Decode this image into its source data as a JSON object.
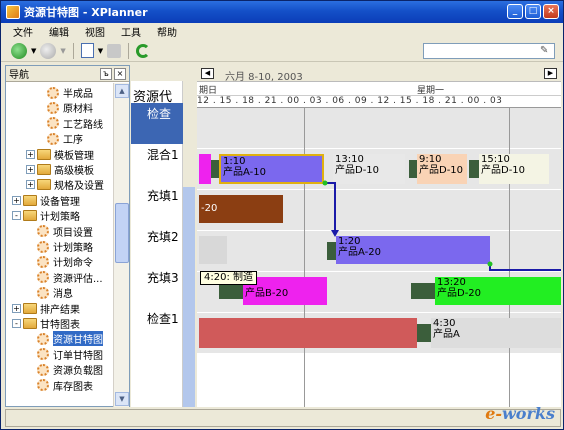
{
  "window": {
    "title": "资源甘特图 - XPlanner"
  },
  "menu": [
    "文件",
    "编辑",
    "视图",
    "工具",
    "帮助"
  ],
  "nav": {
    "title": "导航",
    "items": [
      {
        "label": "半成品",
        "level": 2,
        "icon": "gear-icon"
      },
      {
        "label": "原材料",
        "level": 2,
        "icon": "gear-icon"
      },
      {
        "label": "工艺路线",
        "level": 2,
        "icon": "gear-icon"
      },
      {
        "label": "工序",
        "level": 2,
        "icon": "gear-icon"
      },
      {
        "label": "模板管理",
        "level": 1,
        "icon": "folder-icon",
        "expander": "+"
      },
      {
        "label": "高级模板",
        "level": 1,
        "icon": "folder-icon",
        "expander": "+"
      },
      {
        "label": "规格及设置",
        "level": 1,
        "icon": "folder-icon",
        "expander": "+"
      },
      {
        "label": "设备管理",
        "level": 0,
        "icon": "folder-icon",
        "expander": "+"
      },
      {
        "label": "计划策略",
        "level": 0,
        "icon": "folder-icon",
        "expander": "-"
      },
      {
        "label": "项目设置",
        "level": 1,
        "icon": "gear-icon"
      },
      {
        "label": "计划策略",
        "level": 1,
        "icon": "gear-icon"
      },
      {
        "label": "计划命令",
        "level": 1,
        "icon": "gear-icon"
      },
      {
        "label": "资源评估...",
        "level": 1,
        "icon": "gear-icon"
      },
      {
        "label": "消息",
        "level": 1,
        "icon": "gear-icon"
      },
      {
        "label": "排产结果",
        "level": 0,
        "icon": "folder-icon",
        "expander": "+"
      },
      {
        "label": "甘特图表",
        "level": 0,
        "icon": "folder-icon",
        "expander": "-"
      },
      {
        "label": "资源甘特图",
        "level": 1,
        "icon": "gear-icon",
        "selected": true
      },
      {
        "label": "订单甘特图",
        "level": 1,
        "icon": "gear-icon"
      },
      {
        "label": "资源负载图",
        "level": 1,
        "icon": "gear-icon"
      },
      {
        "label": "库存图表",
        "level": 1,
        "icon": "gear-icon"
      }
    ]
  },
  "codes": {
    "header": "资源代码",
    "rows": [
      "检查",
      "混合1",
      "充填1",
      "充填2",
      "充填3",
      "检查1"
    ]
  },
  "gantt": {
    "header_left": "期日",
    "week_label": "六月 8-10, 2003",
    "day_label": "星期一",
    "hours_row": "12 . 15 . 18 . 21 . 00 . 03 . 06 . 09 . 12 . 15 . 18 . 21 . 00 . 03",
    "tooltip": "4:20: 制造",
    "bars": [
      {
        "time": "1:10",
        "product": "产品A-10",
        "color": "#7b68ee"
      },
      {
        "time": "13:10",
        "product": "产品D-10",
        "color": "#e8e8e8"
      },
      {
        "time": "9:10",
        "product": "产品D-10",
        "color": "#f9d3b5"
      },
      {
        "time": "15:10",
        "product": "产品D-10",
        "color": "#f4f4e4"
      },
      {
        "time": "",
        "product": "-20",
        "color": "#8b3e12"
      },
      {
        "time": "1:20",
        "product": "产品A-20",
        "color": "#7b68ee"
      },
      {
        "time": "20",
        "product": "产品B-20",
        "color": "#ee22ee"
      },
      {
        "time": "13:20",
        "product": "产品D-20",
        "color": "#22ee22"
      },
      {
        "time": "4:30",
        "product": "产品A",
        "color": "#dddddd"
      }
    ]
  },
  "logo": {
    "text1": "e-",
    "text2": "works"
  }
}
